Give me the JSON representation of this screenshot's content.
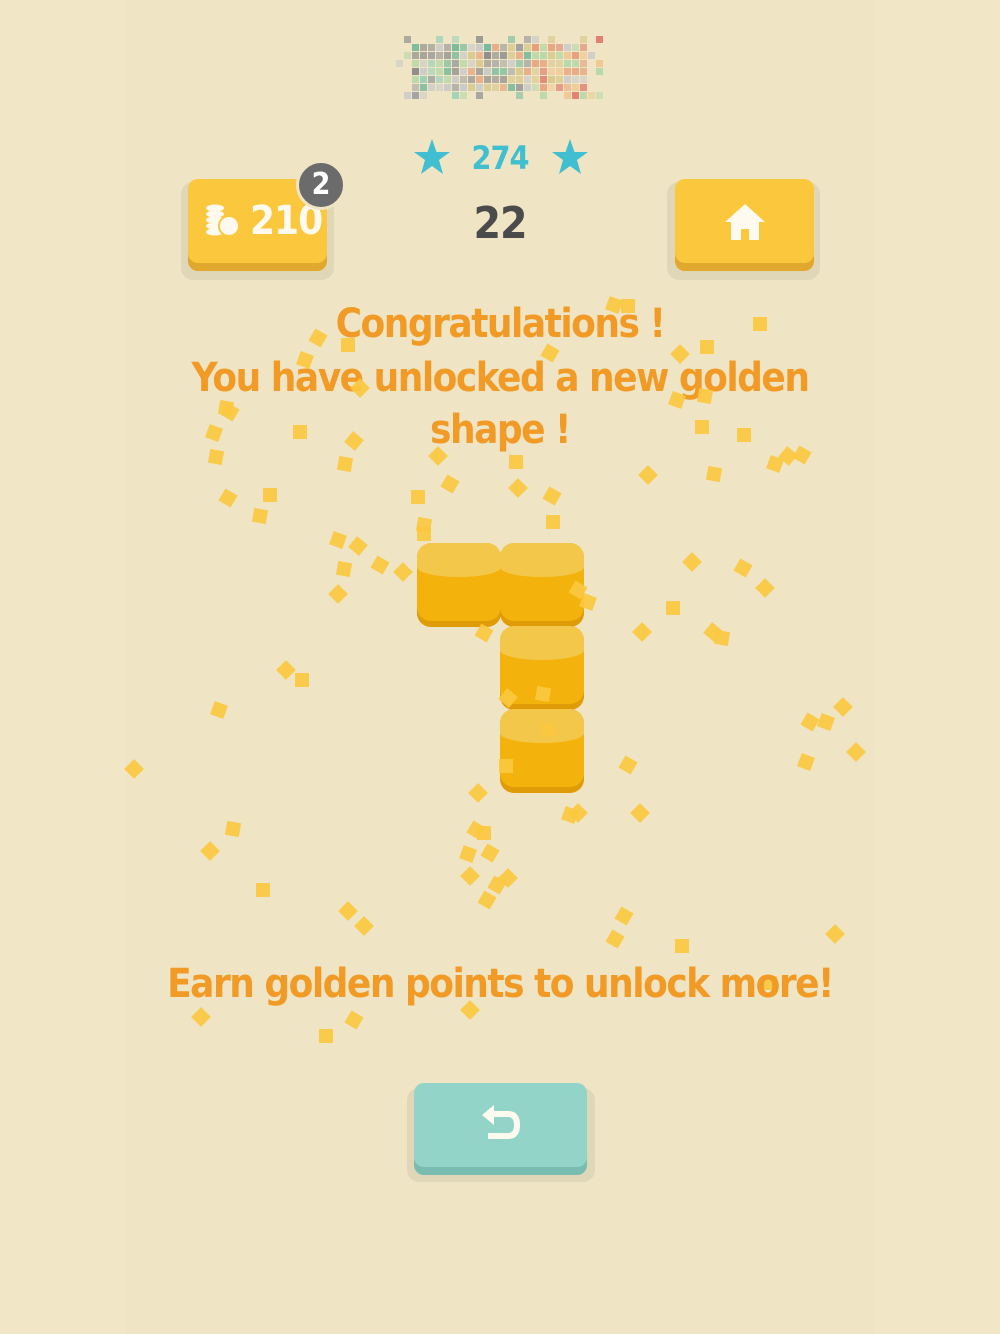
{
  "colors": {
    "background": "#efe5c4",
    "accent_yellow": "#fbc73c",
    "message_orange": "#f19a26",
    "star_teal": "#3fbfd0",
    "back_button_teal": "#92d5c8",
    "gold_block": "#f3b20c"
  },
  "header": {
    "logo_icon": "pixel-mosaic-logo"
  },
  "coins": {
    "icon": "coins-icon",
    "value": "210",
    "badge_count": "2"
  },
  "score": {
    "best": "274",
    "current": "22",
    "star_icon": "star-icon"
  },
  "home_button": {
    "icon": "home-icon"
  },
  "message": {
    "line1": "Congratulations !",
    "line2": "You have unlocked a new golden shape !"
  },
  "golden_shape": {
    "block_count": 4
  },
  "footer_message": "Earn golden points to unlock more!",
  "back_button": {
    "icon": "undo-arrow-icon"
  }
}
